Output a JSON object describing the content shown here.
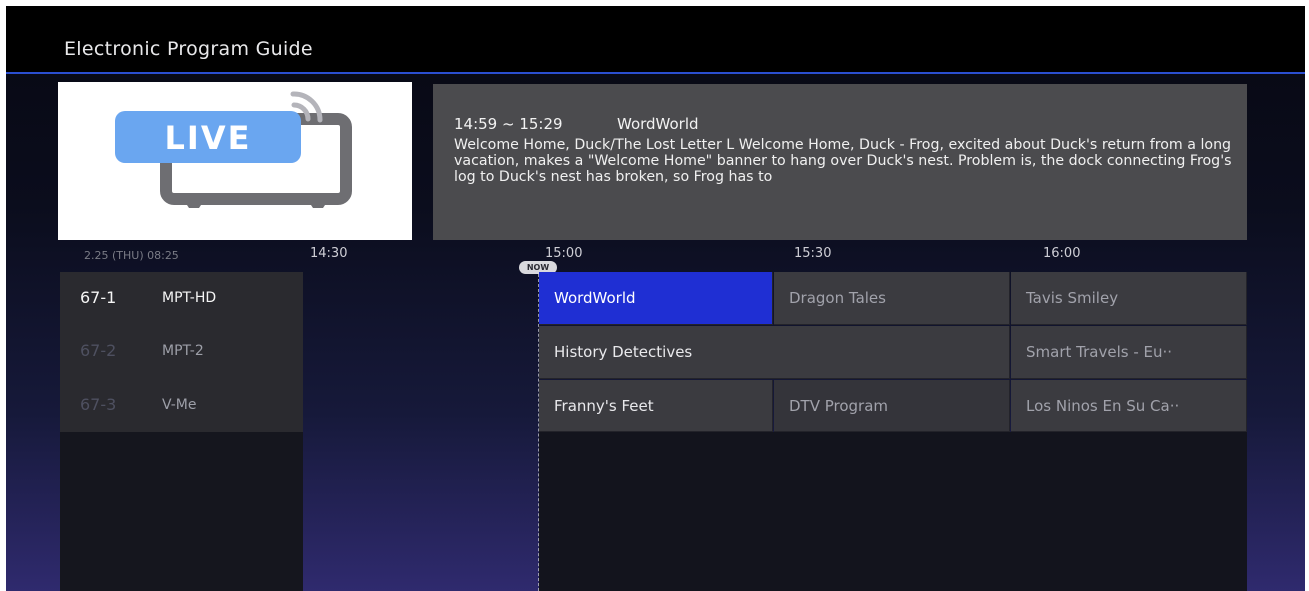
{
  "header": {
    "title": "Electronic Program Guide"
  },
  "preview": {
    "badge_text": "LIVE"
  },
  "info": {
    "time": "14:59 ~ 15:29",
    "title": "WordWorld",
    "description": "Welcome Home, Duck/The Lost Letter L Welcome Home, Duck - Frog, excited about Duck's return from a long vacation, makes a \"Welcome Home\" banner to hang over Duck's nest. Problem is, the dock connecting Frog's log to Duck's nest has broken, so Frog has to"
  },
  "timebar": {
    "date": "2.25 (THU) 08:25",
    "times": [
      "14:30",
      "15:00",
      "15:30",
      "16:00"
    ],
    "now_label": "NOW"
  },
  "channels": [
    {
      "number": "67-1",
      "name": "MPT-HD"
    },
    {
      "number": "67-2",
      "name": "MPT-2"
    },
    {
      "number": "67-3",
      "name": "V-Me"
    }
  ],
  "programs": {
    "row1": [
      "WordWorld",
      "Dragon Tales",
      "Tavis Smiley"
    ],
    "row2": [
      "History Detectives",
      "Smart Travels - Eu··"
    ],
    "row3": [
      "Franny's Feet",
      "DTV Program",
      "Los Ninos En Su Ca··"
    ]
  },
  "colors": {
    "accent": "#1f2fd3",
    "header_line": "#2b4fd0",
    "live_blue": "#6aa6f0"
  },
  "icons": [
    "live-tv-icon",
    "broadcast-waves-icon"
  ]
}
